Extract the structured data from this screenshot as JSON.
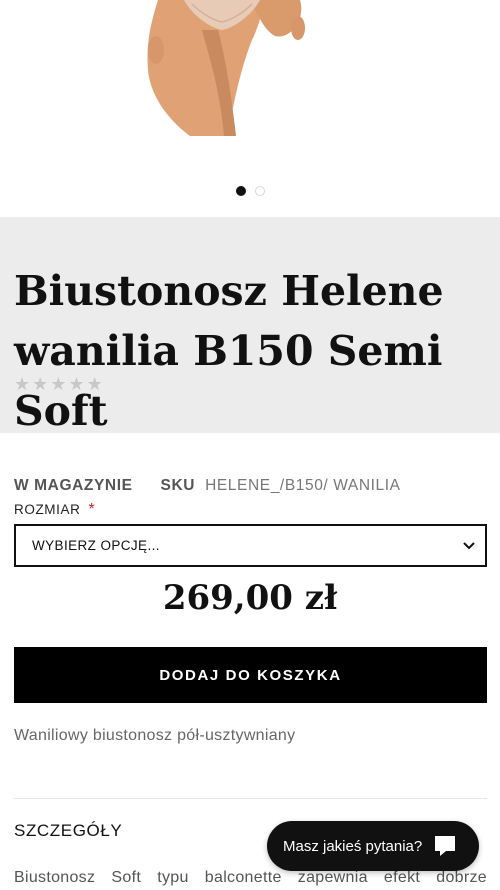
{
  "gallery": {
    "dots": [
      {
        "state": "active"
      },
      {
        "state": "inactive"
      }
    ]
  },
  "product": {
    "title": "Biustonosz Helene wanilia B150 Semi Soft",
    "stars": [
      "★",
      "★",
      "★",
      "★",
      "★"
    ],
    "stock": "W MAGAZYNIE",
    "sku_label": "SKU",
    "sku_value": "HELENE_/B150/ WANILIA",
    "size_label": "ROZMIAR",
    "required_marker": "*",
    "size_select_value": "WYBIERZ OPCJĘ...",
    "price": "269,00 zł",
    "add_to_cart_label": "DODAJ DO KOSZYKA",
    "short_description": "Waniliowy biustonosz pół-usztywniany"
  },
  "details": {
    "heading": "SZCZEGÓŁY",
    "body_start": "Biustonosz Soft typu balconette zapewnia efekt dobrze"
  },
  "chat": {
    "label": "Masz jakieś pytania?"
  },
  "colors": {
    "accent": "#000000",
    "band_bg": "#ececec",
    "required": "#dd2222"
  }
}
